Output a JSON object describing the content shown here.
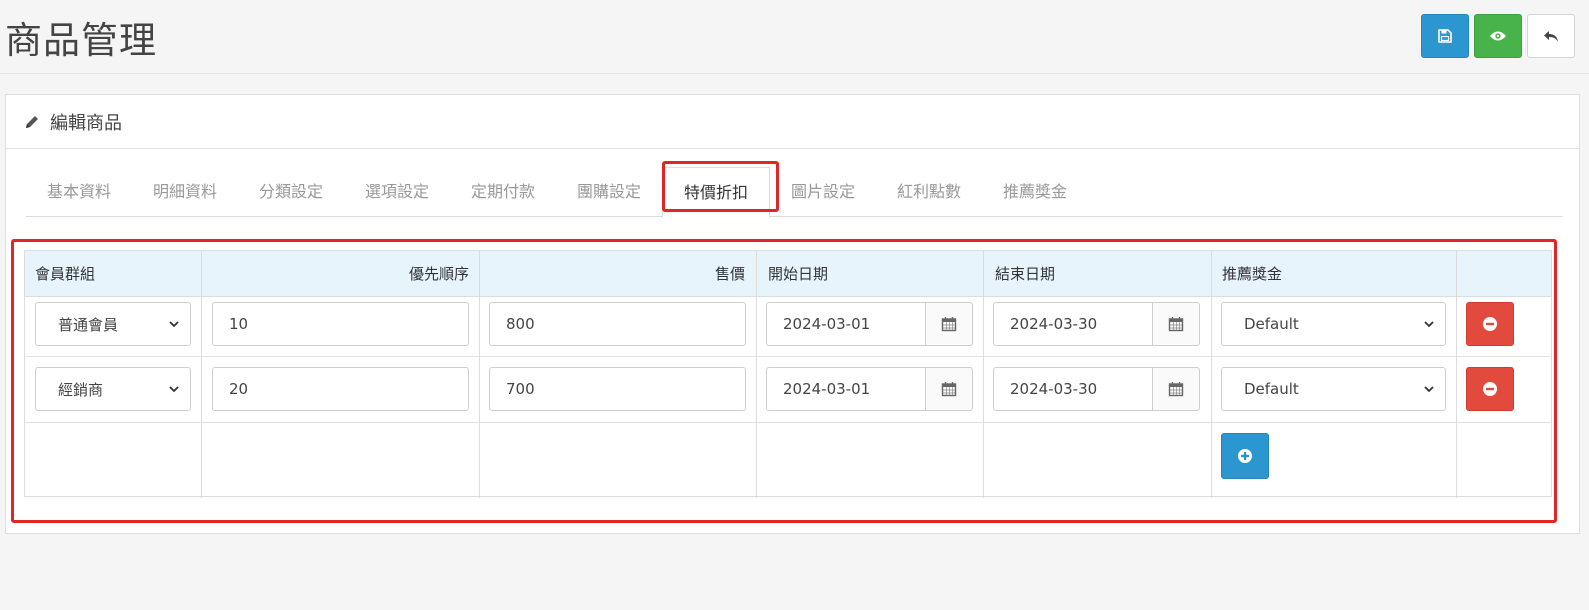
{
  "page": {
    "title": "商品管理"
  },
  "toolbar": {
    "save": "save-icon",
    "preview": "eye-icon",
    "back": "back-icon"
  },
  "panel": {
    "title": "編輯商品",
    "icon": "pencil-icon"
  },
  "tabs": [
    "基本資料",
    "明細資料",
    "分類設定",
    "選項設定",
    "定期付款",
    "團購設定",
    "特價折扣",
    "圖片設定",
    "紅利點數",
    "推薦獎金"
  ],
  "active_tab": "特價折扣",
  "table": {
    "headers": [
      "會員群組",
      "優先順序",
      "售價",
      "開始日期",
      "結束日期",
      "推薦獎金"
    ],
    "rows": [
      {
        "group": "普通會員",
        "priority": "10",
        "price": "800",
        "start": "2024-03-01",
        "end": "2024-03-30",
        "bonus": "Default"
      },
      {
        "group": "經銷商",
        "priority": "20",
        "price": "700",
        "start": "2024-03-01",
        "end": "2024-03-30",
        "bonus": "Default"
      }
    ]
  },
  "colors": {
    "primary": "#2b96cf",
    "success": "#48b24b",
    "danger": "#e34a3e",
    "highlight": "#e02626"
  }
}
